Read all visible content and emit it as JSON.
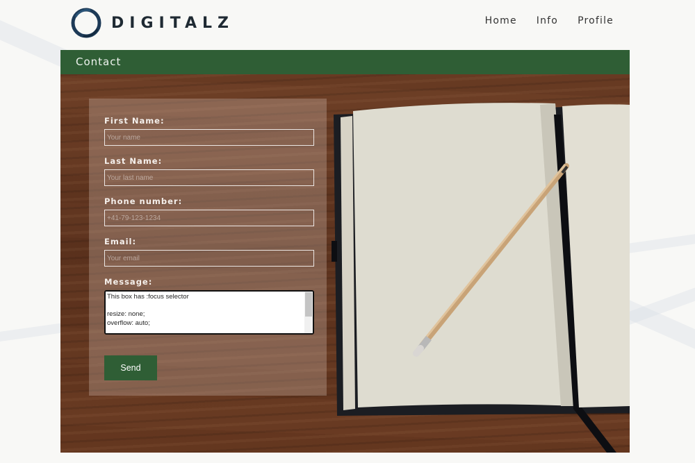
{
  "brand": {
    "name": "DIGITALZ"
  },
  "nav": {
    "items": [
      {
        "label": "Home"
      },
      {
        "label": "Info"
      },
      {
        "label": "Profile"
      }
    ]
  },
  "section": {
    "title": "Contact"
  },
  "form": {
    "first_name": {
      "label": "First Name:",
      "placeholder": "Your name",
      "value": ""
    },
    "last_name": {
      "label": "Last Name:",
      "placeholder": "Your last name",
      "value": ""
    },
    "phone": {
      "label": "Phone number:",
      "placeholder": "+41-79-123-1234",
      "value": ""
    },
    "email": {
      "label": "Email:",
      "placeholder": "Your email",
      "value": ""
    },
    "message": {
      "label": "Message:",
      "value": "This box has :focus selector\n\nresize: none;\noverflow: auto;"
    },
    "send_label": "Send"
  },
  "colors": {
    "accent_green": "#2f5e35",
    "logo_navy": "#1d3a57",
    "text_dark": "#1f2a33"
  }
}
